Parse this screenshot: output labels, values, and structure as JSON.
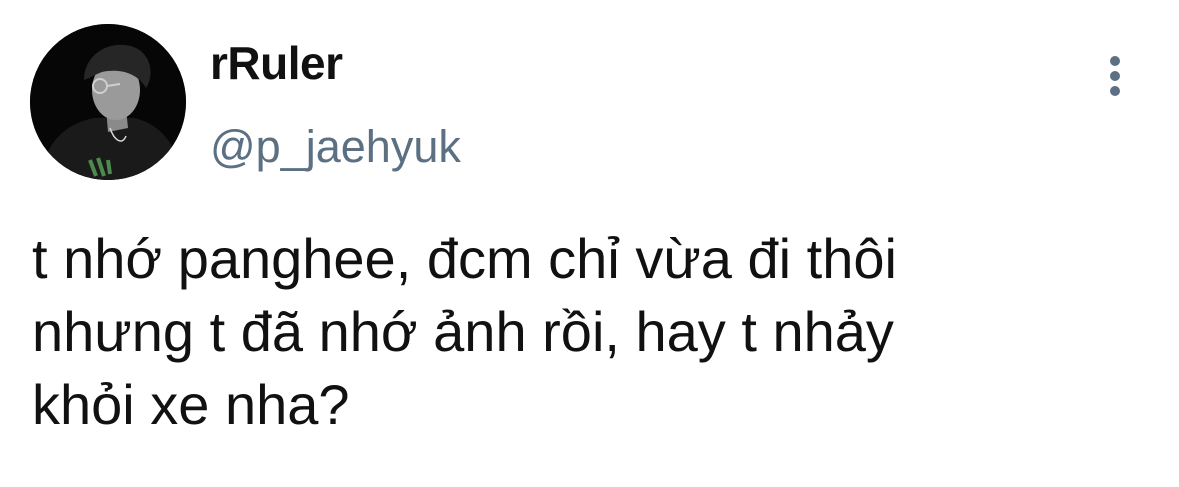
{
  "user": {
    "display_name": "rRuler",
    "handle": "@p_jaehyuk"
  },
  "tweet": {
    "text": "t nhớ panghee, đcm chỉ vừa đi thôi\nnhưng t đã nhớ ảnh rồi, hay t nhảy\nkhỏi xe nha?"
  },
  "icons": {
    "more": "more-vertical-icon"
  },
  "colors": {
    "name": "#111111",
    "handle": "#5b7083",
    "text": "#111111",
    "background": "#ffffff"
  }
}
